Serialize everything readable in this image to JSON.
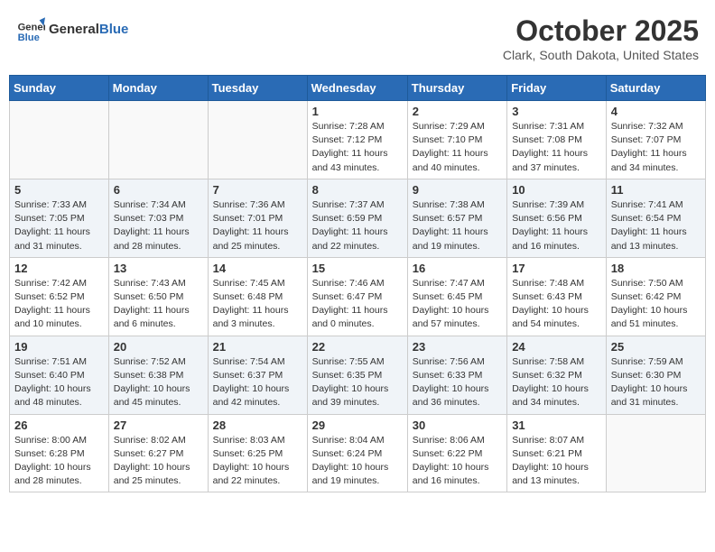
{
  "header": {
    "logo_line1": "General",
    "logo_line2": "Blue",
    "month": "October 2025",
    "location": "Clark, South Dakota, United States"
  },
  "days_of_week": [
    "Sunday",
    "Monday",
    "Tuesday",
    "Wednesday",
    "Thursday",
    "Friday",
    "Saturday"
  ],
  "weeks": [
    [
      {
        "num": "",
        "detail": ""
      },
      {
        "num": "",
        "detail": ""
      },
      {
        "num": "",
        "detail": ""
      },
      {
        "num": "1",
        "detail": "Sunrise: 7:28 AM\nSunset: 7:12 PM\nDaylight: 11 hours\nand 43 minutes."
      },
      {
        "num": "2",
        "detail": "Sunrise: 7:29 AM\nSunset: 7:10 PM\nDaylight: 11 hours\nand 40 minutes."
      },
      {
        "num": "3",
        "detail": "Sunrise: 7:31 AM\nSunset: 7:08 PM\nDaylight: 11 hours\nand 37 minutes."
      },
      {
        "num": "4",
        "detail": "Sunrise: 7:32 AM\nSunset: 7:07 PM\nDaylight: 11 hours\nand 34 minutes."
      }
    ],
    [
      {
        "num": "5",
        "detail": "Sunrise: 7:33 AM\nSunset: 7:05 PM\nDaylight: 11 hours\nand 31 minutes."
      },
      {
        "num": "6",
        "detail": "Sunrise: 7:34 AM\nSunset: 7:03 PM\nDaylight: 11 hours\nand 28 minutes."
      },
      {
        "num": "7",
        "detail": "Sunrise: 7:36 AM\nSunset: 7:01 PM\nDaylight: 11 hours\nand 25 minutes."
      },
      {
        "num": "8",
        "detail": "Sunrise: 7:37 AM\nSunset: 6:59 PM\nDaylight: 11 hours\nand 22 minutes."
      },
      {
        "num": "9",
        "detail": "Sunrise: 7:38 AM\nSunset: 6:57 PM\nDaylight: 11 hours\nand 19 minutes."
      },
      {
        "num": "10",
        "detail": "Sunrise: 7:39 AM\nSunset: 6:56 PM\nDaylight: 11 hours\nand 16 minutes."
      },
      {
        "num": "11",
        "detail": "Sunrise: 7:41 AM\nSunset: 6:54 PM\nDaylight: 11 hours\nand 13 minutes."
      }
    ],
    [
      {
        "num": "12",
        "detail": "Sunrise: 7:42 AM\nSunset: 6:52 PM\nDaylight: 11 hours\nand 10 minutes."
      },
      {
        "num": "13",
        "detail": "Sunrise: 7:43 AM\nSunset: 6:50 PM\nDaylight: 11 hours\nand 6 minutes."
      },
      {
        "num": "14",
        "detail": "Sunrise: 7:45 AM\nSunset: 6:48 PM\nDaylight: 11 hours\nand 3 minutes."
      },
      {
        "num": "15",
        "detail": "Sunrise: 7:46 AM\nSunset: 6:47 PM\nDaylight: 11 hours\nand 0 minutes."
      },
      {
        "num": "16",
        "detail": "Sunrise: 7:47 AM\nSunset: 6:45 PM\nDaylight: 10 hours\nand 57 minutes."
      },
      {
        "num": "17",
        "detail": "Sunrise: 7:48 AM\nSunset: 6:43 PM\nDaylight: 10 hours\nand 54 minutes."
      },
      {
        "num": "18",
        "detail": "Sunrise: 7:50 AM\nSunset: 6:42 PM\nDaylight: 10 hours\nand 51 minutes."
      }
    ],
    [
      {
        "num": "19",
        "detail": "Sunrise: 7:51 AM\nSunset: 6:40 PM\nDaylight: 10 hours\nand 48 minutes."
      },
      {
        "num": "20",
        "detail": "Sunrise: 7:52 AM\nSunset: 6:38 PM\nDaylight: 10 hours\nand 45 minutes."
      },
      {
        "num": "21",
        "detail": "Sunrise: 7:54 AM\nSunset: 6:37 PM\nDaylight: 10 hours\nand 42 minutes."
      },
      {
        "num": "22",
        "detail": "Sunrise: 7:55 AM\nSunset: 6:35 PM\nDaylight: 10 hours\nand 39 minutes."
      },
      {
        "num": "23",
        "detail": "Sunrise: 7:56 AM\nSunset: 6:33 PM\nDaylight: 10 hours\nand 36 minutes."
      },
      {
        "num": "24",
        "detail": "Sunrise: 7:58 AM\nSunset: 6:32 PM\nDaylight: 10 hours\nand 34 minutes."
      },
      {
        "num": "25",
        "detail": "Sunrise: 7:59 AM\nSunset: 6:30 PM\nDaylight: 10 hours\nand 31 minutes."
      }
    ],
    [
      {
        "num": "26",
        "detail": "Sunrise: 8:00 AM\nSunset: 6:28 PM\nDaylight: 10 hours\nand 28 minutes."
      },
      {
        "num": "27",
        "detail": "Sunrise: 8:02 AM\nSunset: 6:27 PM\nDaylight: 10 hours\nand 25 minutes."
      },
      {
        "num": "28",
        "detail": "Sunrise: 8:03 AM\nSunset: 6:25 PM\nDaylight: 10 hours\nand 22 minutes."
      },
      {
        "num": "29",
        "detail": "Sunrise: 8:04 AM\nSunset: 6:24 PM\nDaylight: 10 hours\nand 19 minutes."
      },
      {
        "num": "30",
        "detail": "Sunrise: 8:06 AM\nSunset: 6:22 PM\nDaylight: 10 hours\nand 16 minutes."
      },
      {
        "num": "31",
        "detail": "Sunrise: 8:07 AM\nSunset: 6:21 PM\nDaylight: 10 hours\nand 13 minutes."
      },
      {
        "num": "",
        "detail": ""
      }
    ]
  ]
}
